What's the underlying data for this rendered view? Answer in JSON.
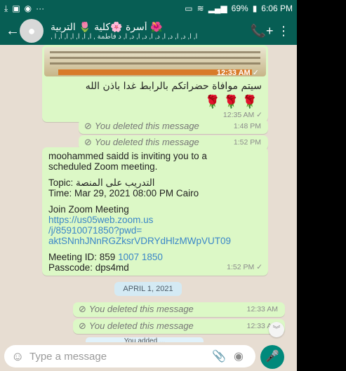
{
  "status_bar": {
    "left_icons": [
      "download-icon",
      "gallery-icon",
      "whatsapp-icon",
      "more-dots-icon"
    ],
    "battery": "69%",
    "time": "6:06 PM"
  },
  "header": {
    "title": "أسرة 🌸كلية 🌷 التربية 🌺",
    "subtitle": ", ا, ا, د, ا, د, ا, د, ا, د, ا, د, ا, د فاطمة , ا, ا, ا, ا, ا, ا, ا",
    "back_label": "←",
    "call_label": "📞+",
    "menu_label": "⋮"
  },
  "messages": {
    "image": {
      "time": "12:33 AM ✓"
    },
    "arabic": {
      "text": "سيتم موافاة حضراتكم بالرابط غدا باذن الله",
      "emoji": "🌹🌹🌹",
      "time": "12:35 AM ✓"
    },
    "deleted_1": {
      "text": "You deleted this message",
      "time": "1:48 PM"
    },
    "deleted_2": {
      "text": "You deleted this message",
      "time": "1:52 PM"
    },
    "zoom": {
      "line1": "moohammed saidd is inviting you to a",
      "line2": "scheduled Zoom meeting.",
      "topic": "Topic: التدريب على المنصة",
      "time_line": "Time: Mar 29, 2021 08:00 PM Cairo",
      "join": "Join Zoom Meeting",
      "link1": "https://us05web.zoom.us",
      "link2": "/j/85910071850?pwd=",
      "link3": "aktSNnhJNnRGZksrVDRYdHlzMWpVUT09",
      "meeting_id_label": "Meeting ID: 859 ",
      "meeting_id_link": "1007 1850",
      "passcode": "Passcode: dps4md",
      "time": "1:52 PM ✓"
    },
    "date_badge": "APRIL 1, 2021",
    "deleted_3": {
      "text": "You deleted this message",
      "time": "12:33 AM"
    },
    "deleted_4": {
      "text": "You deleted this message",
      "time": "12:33 AM"
    },
    "partial": "You added ..."
  },
  "input": {
    "placeholder": "Type a message"
  },
  "colors": {
    "header_bg": "#075e54",
    "bubble_out": "#dcf8c6",
    "chat_bg": "#e7ddd2",
    "mic_bg": "#00897b"
  }
}
